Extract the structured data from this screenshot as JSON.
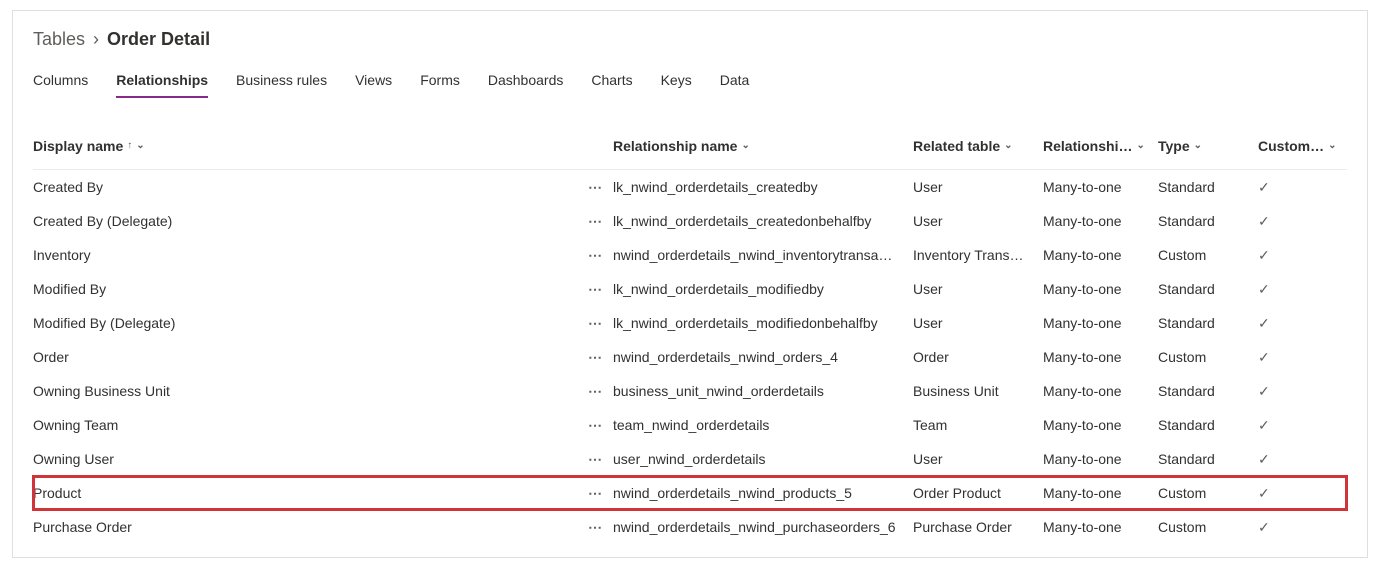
{
  "breadcrumb": {
    "root": "Tables",
    "current": "Order Detail"
  },
  "tabs": [
    {
      "label": "Columns",
      "active": false
    },
    {
      "label": "Relationships",
      "active": true
    },
    {
      "label": "Business rules",
      "active": false
    },
    {
      "label": "Views",
      "active": false
    },
    {
      "label": "Forms",
      "active": false
    },
    {
      "label": "Dashboards",
      "active": false
    },
    {
      "label": "Charts",
      "active": false
    },
    {
      "label": "Keys",
      "active": false
    },
    {
      "label": "Data",
      "active": false
    }
  ],
  "columns": {
    "display_name": "Display name",
    "relationship_name": "Relationship name",
    "related_table": "Related table",
    "relationship_type": "Relationshi…",
    "type": "Type",
    "customizable": "Custom…"
  },
  "rows": [
    {
      "display": "Created By",
      "rel": "lk_nwind_orderdetails_createdby",
      "related": "User",
      "reltype": "Many-to-one",
      "type": "Standard",
      "custom": true,
      "highlight": false
    },
    {
      "display": "Created By (Delegate)",
      "rel": "lk_nwind_orderdetails_createdonbehalfby",
      "related": "User",
      "reltype": "Many-to-one",
      "type": "Standard",
      "custom": true,
      "highlight": false
    },
    {
      "display": "Inventory",
      "rel": "nwind_orderdetails_nwind_inventorytransa…",
      "related": "Inventory Trans…",
      "reltype": "Many-to-one",
      "type": "Custom",
      "custom": true,
      "highlight": false
    },
    {
      "display": "Modified By",
      "rel": "lk_nwind_orderdetails_modifiedby",
      "related": "User",
      "reltype": "Many-to-one",
      "type": "Standard",
      "custom": true,
      "highlight": false
    },
    {
      "display": "Modified By (Delegate)",
      "rel": "lk_nwind_orderdetails_modifiedonbehalfby",
      "related": "User",
      "reltype": "Many-to-one",
      "type": "Standard",
      "custom": true,
      "highlight": false
    },
    {
      "display": "Order",
      "rel": "nwind_orderdetails_nwind_orders_4",
      "related": "Order",
      "reltype": "Many-to-one",
      "type": "Custom",
      "custom": true,
      "highlight": false
    },
    {
      "display": "Owning Business Unit",
      "rel": "business_unit_nwind_orderdetails",
      "related": "Business Unit",
      "reltype": "Many-to-one",
      "type": "Standard",
      "custom": true,
      "highlight": false
    },
    {
      "display": "Owning Team",
      "rel": "team_nwind_orderdetails",
      "related": "Team",
      "reltype": "Many-to-one",
      "type": "Standard",
      "custom": true,
      "highlight": false
    },
    {
      "display": "Owning User",
      "rel": "user_nwind_orderdetails",
      "related": "User",
      "reltype": "Many-to-one",
      "type": "Standard",
      "custom": true,
      "highlight": false
    },
    {
      "display": "Product",
      "rel": "nwind_orderdetails_nwind_products_5",
      "related": "Order Product",
      "reltype": "Many-to-one",
      "type": "Custom",
      "custom": true,
      "highlight": true
    },
    {
      "display": "Purchase Order",
      "rel": "nwind_orderdetails_nwind_purchaseorders_6",
      "related": "Purchase Order",
      "reltype": "Many-to-one",
      "type": "Custom",
      "custom": true,
      "highlight": false
    }
  ]
}
